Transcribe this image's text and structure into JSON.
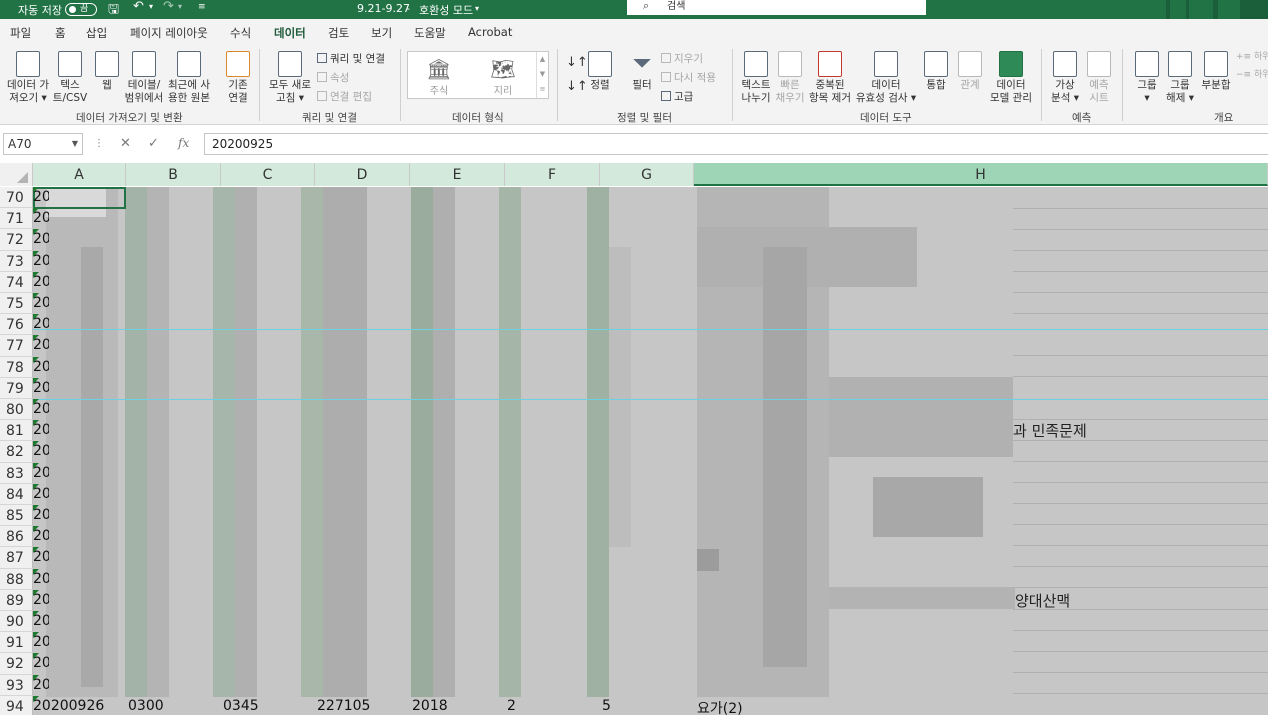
{
  "titlebar": {
    "autosave_label": "자동 저장",
    "autosave_state": "끔",
    "filename": "9.21-9.27",
    "mode": "호환성 모드",
    "search_placeholder": "검색"
  },
  "menu": {
    "tabs": [
      "파일",
      "홈",
      "삽입",
      "페이지 레이아웃",
      "수식",
      "데이터",
      "검토",
      "보기",
      "도움말",
      "Acrobat"
    ],
    "active_tab": "데이터"
  },
  "ribbon": {
    "get_data": {
      "l1": "데이터 가",
      "l2": "져오기"
    },
    "text_csv": {
      "l1": "텍스",
      "l2": "트/CSV"
    },
    "web": "웹",
    "table_range": {
      "l1": "테이블/",
      "l2": "범위에서"
    },
    "recent_sources": {
      "l1": "최근에 사",
      "l2": "용한 원본"
    },
    "existing_conn": {
      "l1": "기존",
      "l2": "연결"
    },
    "refresh_all": {
      "l1": "모두 새로",
      "l2": "고침"
    },
    "queries_conn": "쿼리 및 연결",
    "properties": "속성",
    "edit_links": "연결 편집",
    "stocks": "주식",
    "geography": "지리",
    "sort": "정렬",
    "filter": "필터",
    "clear": "지우기",
    "reapply": "다시 적용",
    "advanced": "고급",
    "text_to_cols": {
      "l1": "텍스트",
      "l2": "나누기"
    },
    "flash_fill": {
      "l1": "빠른",
      "l2": "채우기"
    },
    "remove_dup": {
      "l1": "중복된",
      "l2": "항목 제거"
    },
    "validation": {
      "l1": "데이터",
      "l2": "유효성 검사"
    },
    "consolidate": "통합",
    "relationships": "관계",
    "data_model": {
      "l1": "데이터",
      "l2": "모델 관리"
    },
    "what_if": {
      "l1": "가상",
      "l2": "분석"
    },
    "forecast_sheet": {
      "l1": "예측",
      "l2": "시트"
    },
    "group": "그룹",
    "ungroup": {
      "l1": "그룹",
      "l2": "해제"
    },
    "subtotal": "부분합",
    "show_detail": "하위",
    "hide_detail": "하위",
    "groups": {
      "get_transform": "데이터 가져오기 및 변환",
      "queries": "쿼리 및 연결",
      "data_types": "데이터 형식",
      "sort_filter": "정렬 및 필터",
      "data_tools": "데이터 도구",
      "forecast": "예측",
      "outline": "개요"
    }
  },
  "formula_bar": {
    "name_box": "A70",
    "formula": "20200925"
  },
  "columns": [
    "A",
    "B",
    "C",
    "D",
    "E",
    "F",
    "G",
    "H"
  ],
  "rows": [
    "70",
    "71",
    "72",
    "73",
    "74",
    "75",
    "76",
    "77",
    "78",
    "79",
    "80",
    "81",
    "82",
    "83",
    "84",
    "85",
    "86",
    "87",
    "88",
    "89",
    "90",
    "91",
    "92",
    "93",
    "94"
  ],
  "cells": {
    "a_prefix": "20",
    "row94": {
      "A": "20200926",
      "B": "0300",
      "C": "0345",
      "D": "227105",
      "E": "2018",
      "F": "2",
      "G": "5",
      "H": "요가(2)"
    },
    "h81_text": "과 민족문제",
    "h89_text": "양대산맥"
  },
  "colors": {
    "excel_green": "#217346",
    "selection_teal": "#6ad2e3"
  }
}
